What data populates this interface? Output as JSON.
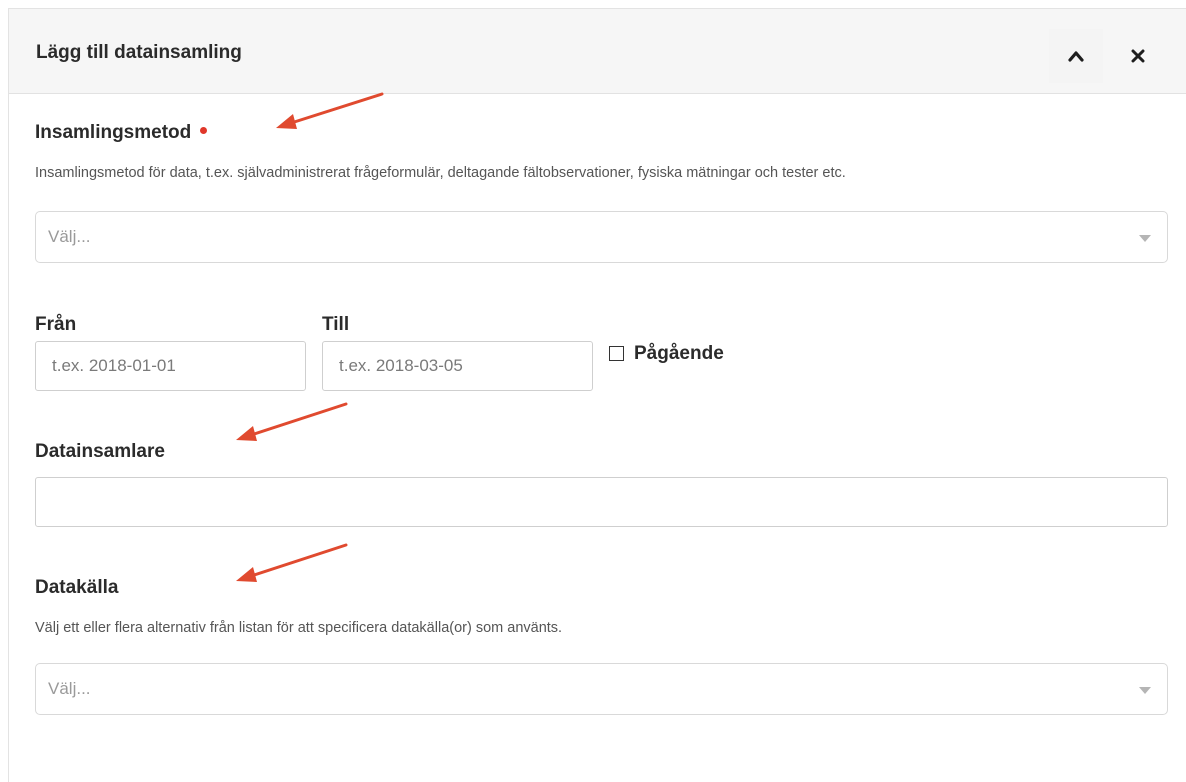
{
  "panel": {
    "title": "Lägg till datainsamling",
    "collapse_icon": "chevron-up-icon",
    "close_icon": "close-icon"
  },
  "method": {
    "label": "Insamlingsmetod",
    "required": true,
    "help": "Insamlingsmetod för data, t.ex. självadministrerat frågeformulär, deltagande fältobservationer, fysiska mätningar och tester etc.",
    "placeholder": "Välj..."
  },
  "dates": {
    "from_label": "Från",
    "from_placeholder": "t.ex. 2018-01-01",
    "to_label": "Till",
    "to_placeholder": "t.ex. 2018-03-05",
    "ongoing_label": "Pågående",
    "ongoing_checked": false
  },
  "collector": {
    "label": "Datainsamlare",
    "value": ""
  },
  "source": {
    "label": "Datakälla",
    "help": "Välj ett eller flera alternativ från listan för att specificera datakälla(or) som använts.",
    "placeholder": "Välj..."
  },
  "annotations": {
    "arrow_color": "#e04a2f",
    "required_dot_color": "#e0372a"
  }
}
